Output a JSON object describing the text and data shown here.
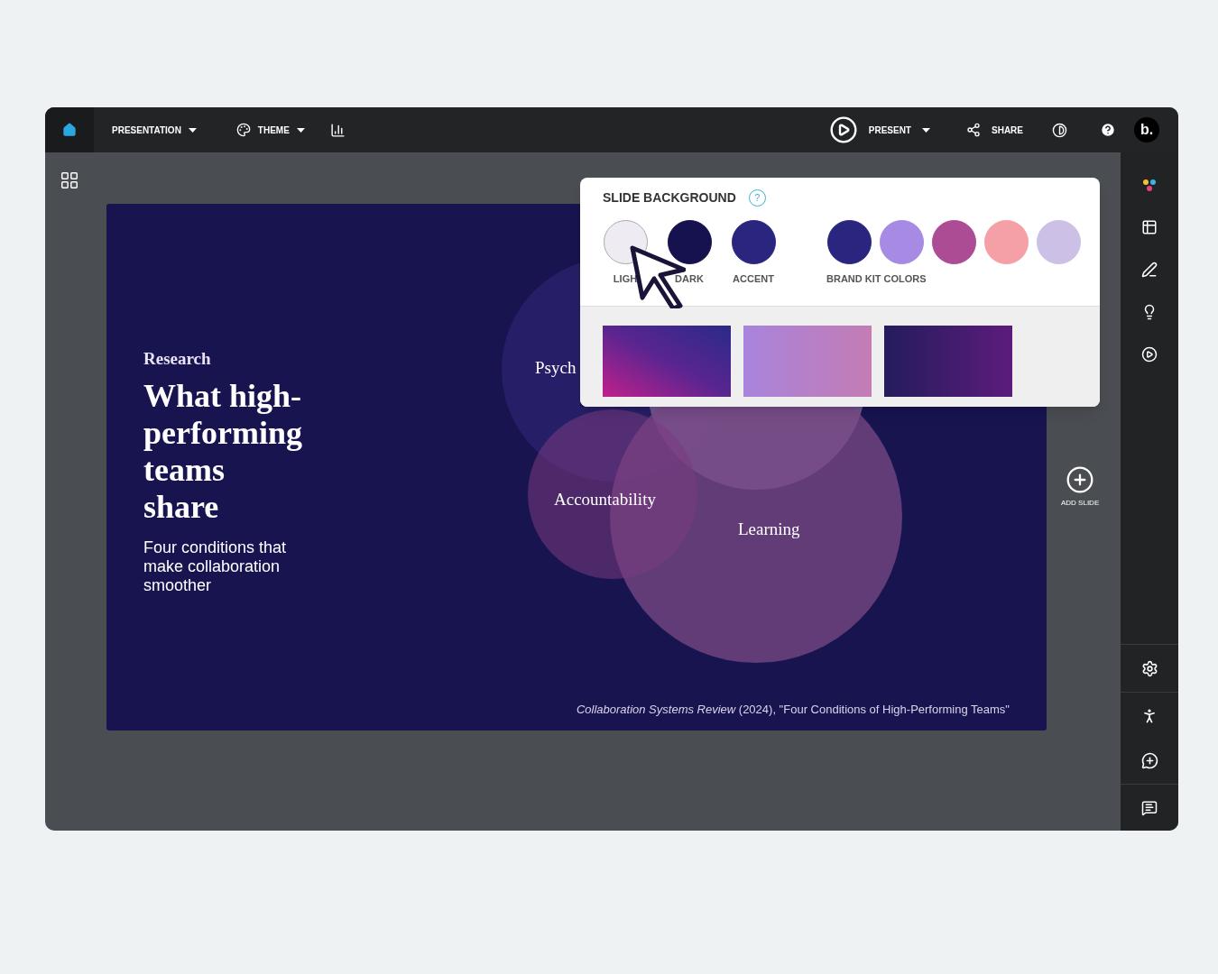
{
  "toolbar": {
    "left": [
      {
        "kind": "menu",
        "label": "PRESENTATION"
      },
      {
        "kind": "theme",
        "label": "THEME"
      },
      {
        "kind": "chart"
      }
    ],
    "right": [
      {
        "kind": "present",
        "label": "PRESENT"
      },
      {
        "kind": "share",
        "label": "SHARE"
      },
      {
        "kind": "contrast"
      },
      {
        "kind": "help"
      }
    ],
    "avatar": "b."
  },
  "slide": {
    "eyebrow": "Research",
    "title": "What high-performing teams share",
    "subtitle": "Four conditions that make collaboration smoother",
    "diagram_labels": [
      "Psych",
      "Accountability",
      "Learning"
    ],
    "source": "*Collaboration Systems Review* (2024), \"Four Conditions of High-Performing Teams\""
  },
  "add_slide": "ADD SLIDE",
  "popover": {
    "title": "SLIDE BACKGROUND",
    "help_mark": "?",
    "theme_swatches": [
      {
        "label": "LIGH",
        "color": "#efebf3"
      },
      {
        "label": "DARK",
        "color": "#15124f"
      },
      {
        "label": "ACCENT",
        "color": "#2a2680"
      }
    ],
    "brand_label": "BRAND KIT COLORS",
    "brand_swatches": [
      {
        "color": "#2a2680"
      },
      {
        "color": "#a68ae4"
      },
      {
        "color": "#ac4c94"
      },
      {
        "color": "#f4a0a6"
      },
      {
        "color": "#cdc0e6"
      }
    ]
  }
}
